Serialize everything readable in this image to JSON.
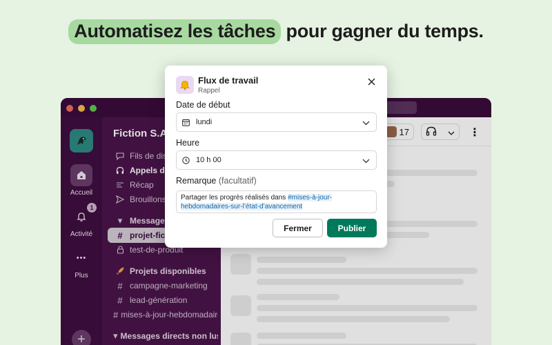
{
  "headline": {
    "highlight": "Automatisez les tâches",
    "rest": " pour gagner du temps."
  },
  "rail": {
    "home_label": "Accueil",
    "activity_label": "Activité",
    "activity_badge": "1",
    "more_label": "Plus",
    "more_glyph": "•••",
    "add_glyph": "+"
  },
  "sidebar": {
    "workspace_name": "Fiction S.A.",
    "caret": "▾",
    "items": [
      {
        "label": "Fils de discussion",
        "icon": "threads-icon"
      },
      {
        "label": "Appels d’équipe",
        "icon": "headphones-icon"
      },
      {
        "label": "Récap",
        "icon": "recap-icon"
      },
      {
        "label": "Brouillons et envoyés",
        "icon": "send-icon"
      }
    ],
    "section_messages": "Messages favoris",
    "channels": [
      {
        "label": "projet-fiction",
        "icon": "#"
      },
      {
        "label": "test-de-produit",
        "icon": "lock-icon"
      }
    ],
    "section_projects": "Projets disponibles",
    "project_channels": [
      {
        "label": "campagne-marketing"
      },
      {
        "label": "lead-génération"
      },
      {
        "label": "mises-à-jour-hebdomadaires"
      }
    ],
    "section_dms": "Messages directs non lus"
  },
  "header": {
    "members_count": "17"
  },
  "modal": {
    "title": "Flux de travail",
    "subtitle": "Rappel",
    "icon": "bell-icon",
    "start_date_label": "Date de début",
    "start_date_value": "lundi",
    "time_label": "Heure",
    "time_value": "10 h 00",
    "note_label": "Remarque",
    "note_optional": "(facultatif)",
    "note_text": "Partager les progrès réalisés dans ",
    "note_link": "#mises-à-jour-hebdomadaires-sur-l’état-d’avancement",
    "cancel_label": "Fermer",
    "publish_label": "Publier"
  },
  "colors": {
    "background": "#e6f2e2",
    "highlight": "#a7d9a0",
    "aubergine": "#4a154b",
    "publish": "#007a5a"
  }
}
